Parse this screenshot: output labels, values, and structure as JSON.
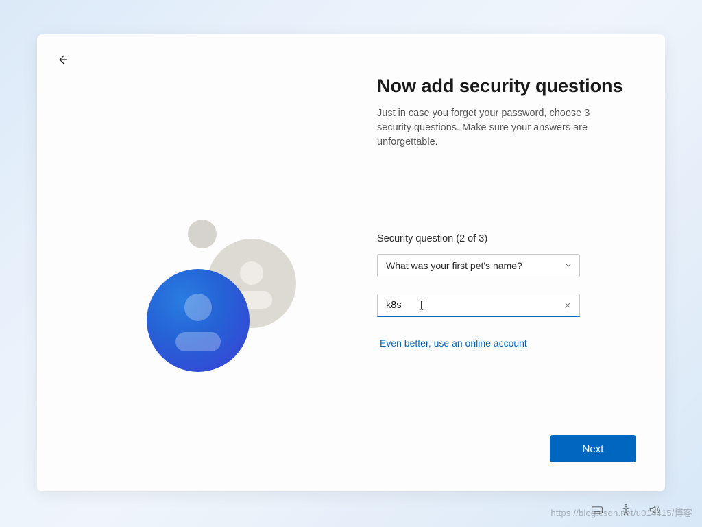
{
  "header": {
    "title": "Now add security questions",
    "subtitle": "Just in case you forget your password, choose 3 security questions. Make sure your answers are unforgettable."
  },
  "form": {
    "label": "Security question (2 of 3)",
    "selected_question": "What was your first pet's name?",
    "answer_value": "k8s",
    "link_text": "Even better, use an online account"
  },
  "actions": {
    "next_label": "Next"
  },
  "watermark": "https://blog.csdn.net/u014415/博客"
}
